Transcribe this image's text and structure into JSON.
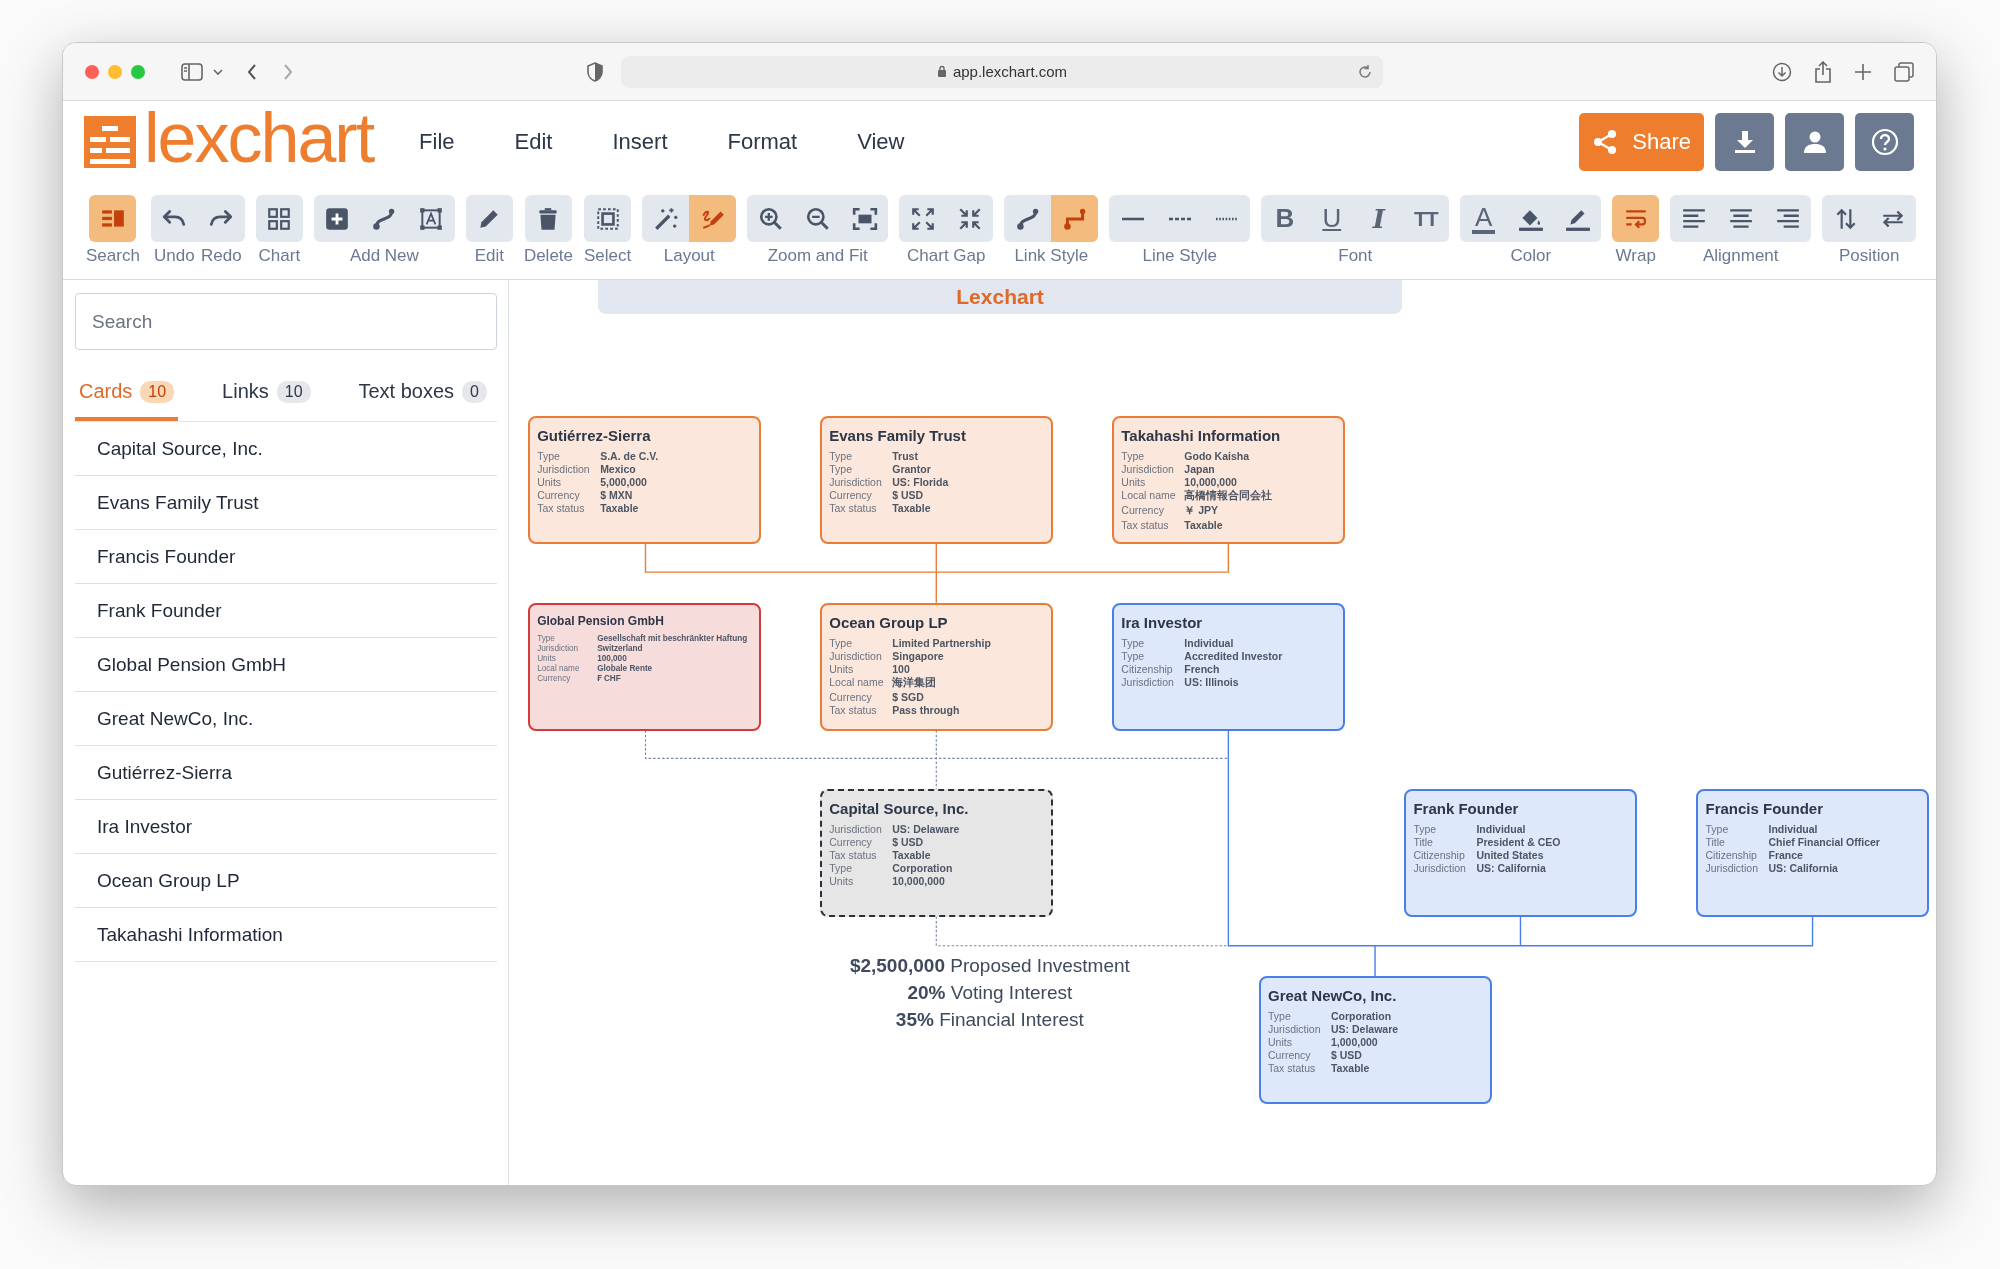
{
  "browser": {
    "url": "app.lexchart.com"
  },
  "app": {
    "logo": "lexchart",
    "menus": [
      "File",
      "Edit",
      "Insert",
      "Format",
      "View"
    ],
    "share_label": "Share"
  },
  "toolbar": [
    {
      "labels": [
        "Search"
      ],
      "buttons": [
        {
          "selected": true
        }
      ]
    },
    {
      "labels": [
        "Undo",
        "Redo"
      ],
      "buttons": [
        {
          "selected": false
        },
        {
          "selected": false
        }
      ]
    },
    {
      "labels": [
        "Chart"
      ],
      "buttons": [
        {
          "selected": false
        }
      ]
    },
    {
      "labels": [
        "Add New"
      ],
      "buttons": [
        {
          "selected": false
        },
        {
          "selected": false
        },
        {
          "selected": false
        }
      ]
    },
    {
      "labels": [
        "Edit"
      ],
      "buttons": [
        {
          "selected": false
        }
      ]
    },
    {
      "labels": [
        "Delete"
      ],
      "buttons": [
        {
          "selected": false
        }
      ]
    },
    {
      "labels": [
        "Select"
      ],
      "buttons": [
        {
          "selected": false
        }
      ]
    },
    {
      "labels": [
        "Layout"
      ],
      "buttons": [
        {
          "selected": false
        },
        {
          "selected": true
        }
      ]
    },
    {
      "labels": [
        "Zoom and Fit"
      ],
      "buttons": [
        {
          "selected": false
        },
        {
          "selected": false
        },
        {
          "selected": false
        }
      ]
    },
    {
      "labels": [
        "Chart Gap"
      ],
      "buttons": [
        {
          "selected": false
        },
        {
          "selected": false
        }
      ]
    },
    {
      "labels": [
        "Link Style"
      ],
      "buttons": [
        {
          "selected": false
        },
        {
          "selected": true
        }
      ]
    },
    {
      "labels": [
        "Line Style"
      ],
      "buttons": [
        {
          "selected": false
        },
        {
          "selected": false
        },
        {
          "selected": false
        }
      ]
    },
    {
      "labels": [
        "Font"
      ],
      "buttons": [
        {
          "glyph": "B",
          "selected": false
        },
        {
          "glyph": "U",
          "selected": false
        },
        {
          "glyph": "I",
          "selected": false
        },
        {
          "glyph": "TT",
          "selected": false
        }
      ]
    },
    {
      "labels": [
        "Color"
      ],
      "buttons": [
        {
          "glyph": "A",
          "selected": false
        },
        {
          "selected": false
        },
        {
          "selected": false
        }
      ]
    },
    {
      "labels": [
        "Wrap"
      ],
      "buttons": [
        {
          "selected": true
        }
      ]
    },
    {
      "labels": [
        "Alignment"
      ],
      "buttons": [
        {
          "selected": false
        },
        {
          "selected": false
        },
        {
          "selected": false
        }
      ]
    },
    {
      "labels": [
        "Position"
      ],
      "buttons": [
        {
          "selected": false
        },
        {
          "selected": false
        }
      ]
    }
  ],
  "sidebar": {
    "search": {
      "placeholder": "Search"
    },
    "tabs": [
      {
        "label": "Cards",
        "count": "10",
        "selected": true
      },
      {
        "label": "Links",
        "count": "10",
        "selected": false
      },
      {
        "label": "Text boxes",
        "count": "0",
        "selected": false
      }
    ],
    "items": [
      "Capital Source, Inc.",
      "Evans Family Trust",
      "Francis Founder",
      "Frank Founder",
      "Global Pension GmbH",
      "Great NewCo, Inc.",
      "Gutiérrez-Sierra",
      "Ira Investor",
      "Ocean Group LP",
      "Takahashi Information"
    ]
  },
  "canvas": {
    "title": "Lexchart",
    "cards": [
      {
        "title": "Gutiérrez-Sierra",
        "color": "#e97c36",
        "dashed": false,
        "fields": [
          {
            "label": "Type",
            "value": "S.A. de C.V."
          },
          {
            "label": "Jurisdiction",
            "value": "Mexico"
          },
          {
            "label": "Units",
            "value": "5,000,000"
          },
          {
            "label": "Currency",
            "value": "$ MXN"
          },
          {
            "label": "Tax status",
            "value": "Taxable"
          }
        ]
      },
      {
        "title": "Evans Family Trust",
        "color": "#e97c36",
        "dashed": false,
        "fields": [
          {
            "label": "Type",
            "value": "Trust"
          },
          {
            "label": "Type",
            "value": "Grantor"
          },
          {
            "label": "Jurisdiction",
            "value": "US: Florida"
          },
          {
            "label": "Currency",
            "value": "$ USD"
          },
          {
            "label": "Tax status",
            "value": "Taxable"
          }
        ]
      },
      {
        "title": "Takahashi Information",
        "color": "#e97c36",
        "dashed": false,
        "fields": [
          {
            "label": "Type",
            "value": "Godo Kaisha"
          },
          {
            "label": "Jurisdiction",
            "value": "Japan"
          },
          {
            "label": "Units",
            "value": "10,000,000"
          },
          {
            "label": "Local name",
            "value": "高橋情報合同会社"
          },
          {
            "label": "Currency",
            "value": "￥ JPY"
          },
          {
            "label": "Tax status",
            "value": "Taxable"
          }
        ]
      },
      {
        "title": "Global Pension GmbH",
        "color": "#d33b3b",
        "dashed": false,
        "fields": [
          {
            "label": "Type",
            "value": "Gesellschaft mit beschränkter Haftung"
          },
          {
            "label": "Jurisdiction",
            "value": "Switzerland"
          },
          {
            "label": "Units",
            "value": "100,000"
          },
          {
            "label": "Local name",
            "value": "Globale Rente"
          },
          {
            "label": "Currency",
            "value": "₣ CHF"
          }
        ]
      },
      {
        "title": "Ocean Group LP",
        "color": "#e97c36",
        "dashed": false,
        "fields": [
          {
            "label": "Type",
            "value": "Limited Partnership"
          },
          {
            "label": "Jurisdiction",
            "value": "Singapore"
          },
          {
            "label": "Units",
            "value": "100"
          },
          {
            "label": "Local name",
            "value": "海洋集团"
          },
          {
            "label": "Currency",
            "value": "$ SGD"
          },
          {
            "label": "Tax status",
            "value": "Pass through"
          }
        ]
      },
      {
        "title": "Ira Investor",
        "color": "#4a7fe8",
        "dashed": false,
        "fields": [
          {
            "label": "Type",
            "value": "Individual"
          },
          {
            "label": "Type",
            "value": "Accredited Investor"
          },
          {
            "label": "Citizenship",
            "value": "French"
          },
          {
            "label": "Jurisdiction",
            "value": "US: Illinois"
          }
        ]
      },
      {
        "title": "Capital Source, Inc.",
        "color": "#2b2f38",
        "dashed": true,
        "fields": [
          {
            "label": "Jurisdiction",
            "value": "US: Delaware"
          },
          {
            "label": "Currency",
            "value": "$ USD"
          },
          {
            "label": "Tax status",
            "value": "Taxable"
          },
          {
            "label": "Type",
            "value": "Corporation"
          },
          {
            "label": "Units",
            "value": "10,000,000"
          }
        ]
      },
      {
        "title": "Frank Founder",
        "color": "#4a7fe8",
        "dashed": false,
        "fields": [
          {
            "label": "Type",
            "value": "Individual"
          },
          {
            "label": "Title",
            "value": "President & CEO"
          },
          {
            "label": "Citizenship",
            "value": "United States"
          },
          {
            "label": "Jurisdiction",
            "value": "US: California"
          }
        ]
      },
      {
        "title": "Francis Founder",
        "color": "#4a7fe8",
        "dashed": false,
        "fields": [
          {
            "label": "Type",
            "value": "Individual"
          },
          {
            "label": "Title",
            "value": "Chief Financial Officer"
          },
          {
            "label": "Citizenship",
            "value": "France"
          },
          {
            "label": "Jurisdiction",
            "value": "US: California"
          }
        ]
      },
      {
        "title": "Great NewCo, Inc.",
        "color": "#4a7fe8",
        "dashed": false,
        "fields": [
          {
            "label": "Type",
            "value": "Corporation"
          },
          {
            "label": "Jurisdiction",
            "value": "US: Delaware"
          },
          {
            "label": "Units",
            "value": "1,000,000"
          },
          {
            "label": "Currency",
            "value": "$ USD"
          },
          {
            "label": "Tax status",
            "value": "Taxable"
          }
        ]
      }
    ],
    "investment": [
      "**$2,500,000** Proposed Investment",
      "**20%** Voting Interest",
      "**35%** Financial Interest"
    ]
  }
}
